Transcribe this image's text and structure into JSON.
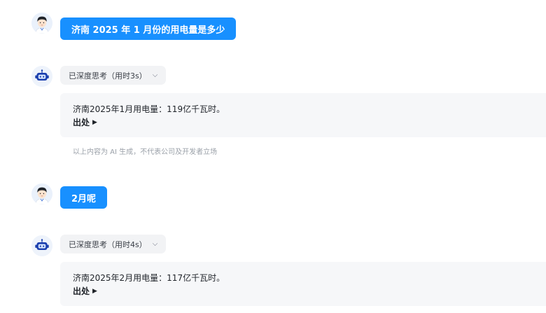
{
  "conversation": {
    "q1": {
      "text": "济南 2025 年 1 月份的用电量是多少"
    },
    "a1": {
      "think_label": "已深度思考（用时3s）",
      "answer": "济南2025年1月用电量：119亿千瓦时。",
      "source_label": "出处",
      "disclaimer": "以上内容为 AI 生成，不代表公司及开发者立场"
    },
    "q2": {
      "text": "2月呢"
    },
    "a2": {
      "think_label": "已深度思考（用时4s）",
      "answer": "济南2025年2月用电量：117亿千瓦时。",
      "source_label": "出处"
    }
  },
  "icons": {
    "user_avatar": "user-avatar-icon",
    "bot_avatar": "robot-icon",
    "chevron": "chevron-down-icon",
    "source_arrow": "caret-right-icon"
  },
  "colors": {
    "accent": "#1890ff",
    "answer_bg": "#f6f7f9",
    "pill_bg": "#f2f3f5"
  }
}
